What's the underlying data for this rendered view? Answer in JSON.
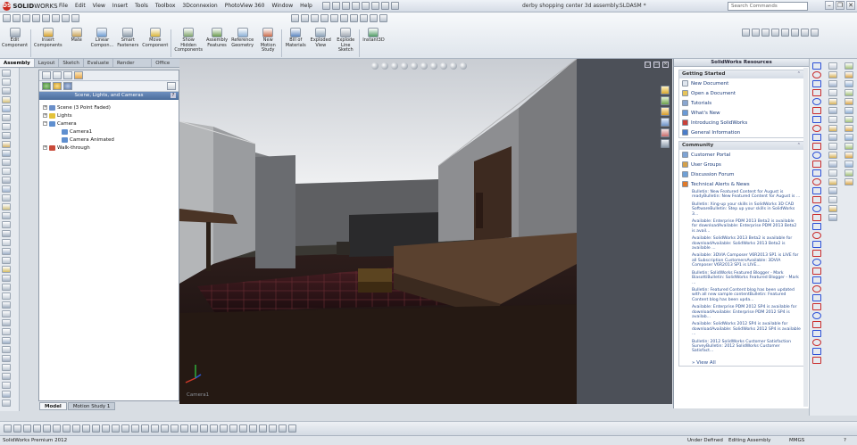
{
  "app": {
    "logo_ds": "DS",
    "logo_solid": "SOLID",
    "logo_works": "WORKS",
    "document_title": "derby shopping center 3d assembly.SLDASM *",
    "search_placeholder": "Search Commands"
  },
  "menu": [
    "File",
    "Edit",
    "View",
    "Insert",
    "Tools",
    "Toolbox",
    "3Dconnexion",
    "PhotoView 360",
    "Window",
    "Help"
  ],
  "window_controls": [
    "–",
    "❐",
    "✕"
  ],
  "ribbon": {
    "commands": [
      {
        "label": "Edit\nComponent",
        "icon": "edit-component-icon",
        "color": "#9aa7b5"
      },
      {
        "label": "Insert\nComponents",
        "icon": "insert-components-icon",
        "color": "#d6a12a"
      },
      {
        "label": "Mate",
        "icon": "mate-icon",
        "color": "#c9a45a"
      },
      {
        "label": "Linear\nCompon...",
        "icon": "linear-pattern-icon",
        "color": "#6d9bd1"
      },
      {
        "label": "Smart\nFasteners",
        "icon": "smart-fasteners-icon",
        "color": "#8c9aa8"
      },
      {
        "label": "Move\nComponent",
        "icon": "move-component-icon",
        "color": "#d8b43a"
      },
      {
        "label": "Show\nHidden\nComponents",
        "icon": "show-hidden-icon",
        "color": "#7fa36b"
      },
      {
        "label": "Assembly\nFeatures",
        "icon": "assembly-features-icon",
        "color": "#6a9a4e"
      },
      {
        "label": "Reference\nGeometry",
        "icon": "reference-geometry-icon",
        "color": "#8bb0d6"
      },
      {
        "label": "New\nMotion\nStudy",
        "icon": "new-motion-study-icon",
        "color": "#c96a4a"
      },
      {
        "label": "Bill of\nMaterials",
        "icon": "bill-of-materials-icon",
        "color": "#5c86bf"
      },
      {
        "label": "Exploded\nView",
        "icon": "exploded-view-icon",
        "color": "#8aa0b6"
      },
      {
        "label": "Explode\nLine\nSketch",
        "icon": "explode-line-sketch-icon",
        "color": "#a0a8b2"
      },
      {
        "label": "Instant3D",
        "icon": "instant3d-icon",
        "color": "#4f9a64"
      }
    ]
  },
  "command_tabs": [
    {
      "label": "Assembly",
      "active": true
    },
    {
      "label": "Layout",
      "active": false
    },
    {
      "label": "Sketch",
      "active": false
    },
    {
      "label": "Evaluate",
      "active": false
    },
    {
      "label": "Render Tools",
      "active": false
    },
    {
      "label": "Office Products",
      "active": false
    }
  ],
  "feature_panel": {
    "header": "Scene, Lights, and Cameras",
    "pin": "?",
    "tree": [
      {
        "label": "Scene (3 Point Faded)",
        "indent": 0,
        "expander": "+",
        "icon": "scene-icon",
        "color": "#6a8fc9"
      },
      {
        "label": "Lights",
        "indent": 0,
        "expander": "+",
        "icon": "lights-icon",
        "color": "#e3c23a"
      },
      {
        "label": "Camera",
        "indent": 0,
        "expander": "−",
        "icon": "camera-icon",
        "color": "#5f8fcf"
      },
      {
        "label": "Camera1",
        "indent": 1,
        "expander": "",
        "icon": "camera-icon",
        "color": "#5f8fcf"
      },
      {
        "label": "Camera Animated",
        "indent": 1,
        "expander": "",
        "icon": "camera-icon",
        "color": "#5f8fcf"
      },
      {
        "label": "Walk-through",
        "indent": 0,
        "expander": "+",
        "icon": "walkthrough-icon",
        "color": "#c94a3a"
      }
    ]
  },
  "viewport": {
    "label": "Camera1",
    "controls": [
      "▢",
      "▭",
      "✕"
    ]
  },
  "resources": {
    "title": "SolidWorks Resources",
    "getting_started": {
      "header": "Getting Started",
      "items": [
        {
          "label": "New Document",
          "icon": "new-document-icon",
          "color": "#e0e6ee"
        },
        {
          "label": "Open a Document",
          "icon": "open-document-icon",
          "color": "#e7c45a"
        },
        {
          "label": "Tutorials",
          "icon": "tutorials-icon",
          "color": "#8aa6cf"
        },
        {
          "label": "What's New",
          "icon": "whats-new-icon",
          "color": "#6a9ad6"
        },
        {
          "label": "Introducing SolidWorks",
          "icon": "introducing-icon",
          "color": "#c9413a"
        },
        {
          "label": "General Information",
          "icon": "info-icon",
          "color": "#4a7cc9"
        }
      ]
    },
    "community": {
      "header": "Community",
      "items": [
        {
          "label": "Customer Portal",
          "icon": "customer-portal-icon",
          "color": "#7ea3d4"
        },
        {
          "label": "User Groups",
          "icon": "user-groups-icon",
          "color": "#d4a04a"
        },
        {
          "label": "Discussion Forum",
          "icon": "discussion-forum-icon",
          "color": "#6fa0d6"
        },
        {
          "label": "Technical Alerts & News",
          "icon": "technical-alerts-icon",
          "color": "#e07a2a"
        }
      ]
    },
    "news": [
      "Bulletin: New Featured Content for August is readyBulletin: New Featured Content for August is ...",
      "Bulletin: Xing-up your skills in SolidWorks 3D CAD SoftwareBulletin: Step up your skills in SolidWorks 3...",
      "Available: Enterprise PDM 2013 Beta2 is available for downloadAvailable: Enterprise PDM 2013 Beta2 is avail...",
      "Available: SolidWorks 2013 Beta2 is available for downloadAvailable: SolidWorks 2013 Beta2 is available ...",
      "Available: 3DVIA Composer V6R2013 SP1 is LIVE for all Subscription CustomersAvailable: 3DVIA Composer V6R2013 SP1 is LIVE...",
      "Bulletin: SolidWorks Featured Blogger - Mark BiasottiBulletin: SolidWorks Featured Blogger - Mark ...",
      "Bulletin: Featured Content blog has been updated with all new sample contentBulletin: Featured Content blog has been upda...",
      "Available: Enterprise PDM 2012 SP4 is available for downloadAvailable: Enterprise PDM 2012 SP4 is availab...",
      "Available: SolidWorks 2012 SP4 is available for downloadAvailable: SolidWorks 2012 SP4 is available ...",
      "Bulletin: 2012 SolidWorks Customer Satisfaction SurveyBulletin: 2012 SolidWorks Customer Satisfact..."
    ],
    "view_all": "» View All"
  },
  "bottom_tabs": [
    {
      "label": "Model",
      "active": true
    },
    {
      "label": "Motion Study 1",
      "active": false
    }
  ],
  "status": {
    "product": "SolidWorks Premium 2012",
    "state": "Under Defined",
    "mode": "Editing Assembly",
    "units": "MMGS",
    "help": "?"
  }
}
